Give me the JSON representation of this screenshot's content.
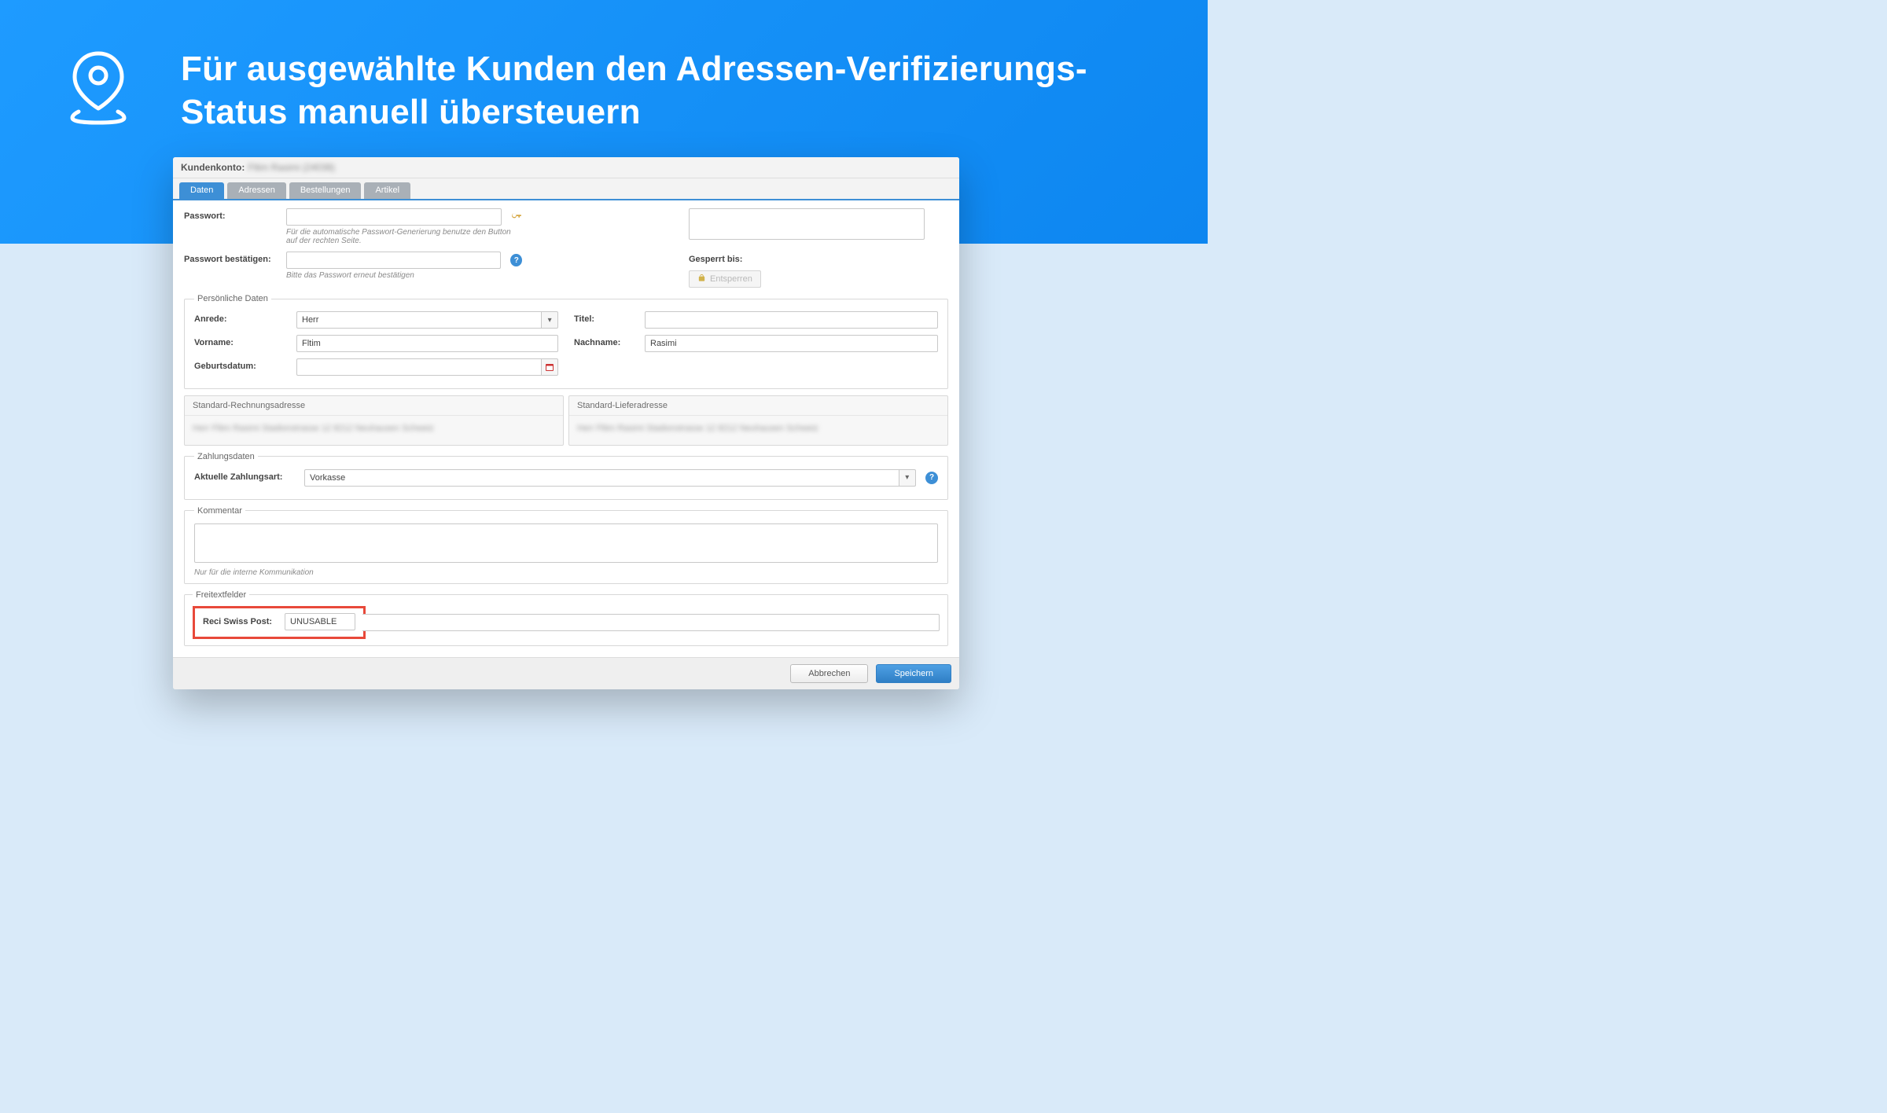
{
  "hero": {
    "title": "Für ausgewählte Kunden den Adressen-Verifizierungs-Status manuell übersteuern"
  },
  "panel": {
    "header_label": "Kundenkonto:",
    "header_blur": "Fltim Rasimi (24038)"
  },
  "tabs": [
    {
      "label": "Daten",
      "active": true
    },
    {
      "label": "Adressen",
      "active": false
    },
    {
      "label": "Bestellungen",
      "active": false
    },
    {
      "label": "Artikel",
      "active": false
    }
  ],
  "password": {
    "label": "Passwort:",
    "hint": "Für die automatische Passwort-Generierung benutze den Button auf der rechten Seite.",
    "confirm_label": "Passwort bestätigen:",
    "confirm_hint": "Bitte das Passwort erneut bestätigen",
    "locked_until_label": "Gesperrt bis:",
    "unlock_label": "Entsperren"
  },
  "personal": {
    "legend": "Persönliche Daten",
    "salutation_label": "Anrede:",
    "salutation_value": "Herr",
    "title_label": "Titel:",
    "title_value": "",
    "firstname_label": "Vorname:",
    "firstname_value": "Fltim",
    "lastname_label": "Nachname:",
    "lastname_value": "Rasimi",
    "dob_label": "Geburtsdatum:",
    "dob_value": ""
  },
  "addresses": {
    "billing_title": "Standard-Rechnungsadresse",
    "shipping_title": "Standard-Lieferadresse",
    "blur_text": "Herr Fltim Rasimi\nStadionstrasse 12\n8212 Neuhausen\nSchweiz"
  },
  "payment": {
    "legend": "Zahlungsdaten",
    "method_label": "Aktuelle Zahlungsart:",
    "method_value": "Vorkasse"
  },
  "comment": {
    "legend": "Kommentar",
    "hint": "Nur für die interne Kommunikation"
  },
  "freitext": {
    "legend": "Freitextfelder",
    "field_label": "Reci Swiss Post:",
    "field_value": "UNUSABLE"
  },
  "buttons": {
    "cancel": "Abbrechen",
    "save": "Speichern"
  }
}
